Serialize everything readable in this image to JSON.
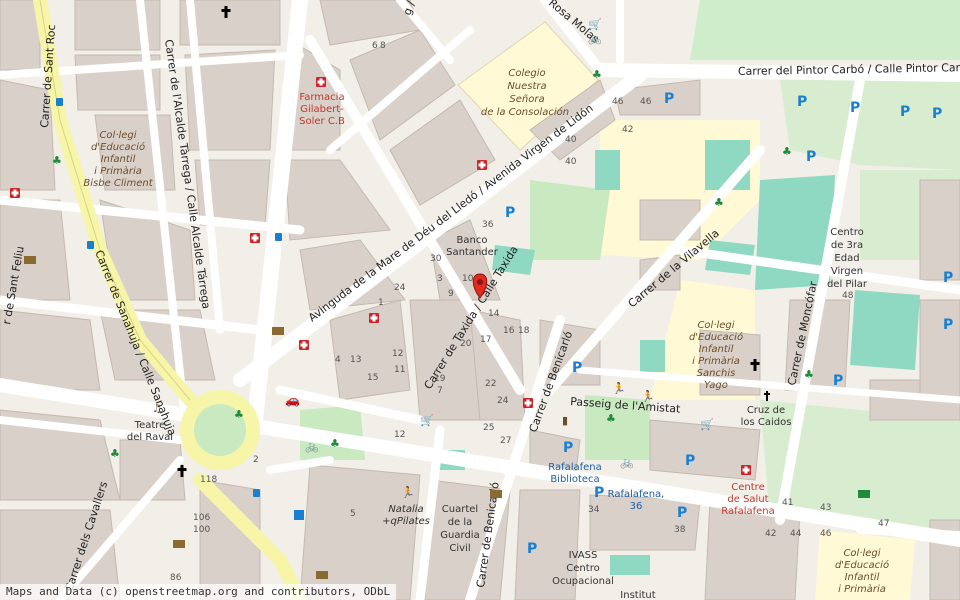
{
  "streets": {
    "pintor_carbo": "Carrer del Pintor Carbó / Calle Pintor Carbó",
    "mare_deu_lledo": "Avinguda de la Mare de Déu del Lledó / Avenida Virgen de Lidón",
    "sanahuja": "Carrer de Sanahuja / Calle Sanahuja",
    "alcalde_tarrega": "Carrer de l'Alcalde Tàrrega / Calle Alcalde Tárrega",
    "sant_roc": "Carrer de Sant Roc",
    "sant_feliu": "r de Sant Feliu",
    "taxida": "Carrer de Taxida / Calle Taxida",
    "benicarlo_1": "Carrer de Benicarló",
    "benicarlo_2": "Carrer de Benicarló",
    "vilavella": "Carrer de la Vilavella",
    "moncofar": "Carrer de Moncófar",
    "amistat": "Passeig de l'Amistat",
    "cavallers": "Carrer dels Cavallers",
    "puig": "g / Calle del Puig",
    "rosa_molas": "Rosa Molas"
  },
  "pois": {
    "colegio_nuestra": [
      "Colegio",
      "Nuestra",
      "Señora",
      "de la Consolación"
    ],
    "farmacia": [
      "Farmacia",
      "Gilabert-",
      "Soler C.B"
    ],
    "collegi_bisbe": [
      "Col·legi",
      "d'Educació",
      "Infantil",
      "i Primària",
      "Bisbe Climent"
    ],
    "banco": [
      "Banco",
      "Santander"
    ],
    "centro_3ra": [
      "Centro",
      "de 3ra",
      "Edad",
      "Virgen",
      "del Pilar"
    ],
    "collegi_sanchis": [
      "Col·legi",
      "d'Educació",
      "Infantil",
      "i Primària",
      "Sanchis",
      "Yago"
    ],
    "cruz": [
      "Cruz de",
      "los Caidos"
    ],
    "teatre": [
      "Teatre",
      "del Raval"
    ],
    "biblioteca": [
      "Rafalafena",
      "Biblioteca"
    ],
    "rafalafena_36": [
      "Rafalafena,",
      "36"
    ],
    "centre_salut": [
      "Centre",
      "de Salut",
      "Rafalafena"
    ],
    "cuartel": [
      "Cuartel",
      "de la",
      "Guardia",
      "Civil"
    ],
    "natalia": [
      "Natalia",
      "+qPilates"
    ],
    "ivass": [
      "IVASS",
      "Centro",
      "Ocupacional"
    ],
    "collegi_bottom": [
      "Col·legi",
      "d'Educació",
      "Infantil",
      "i Primària"
    ],
    "institut": "Institut"
  },
  "house_numbers": {
    "n6": "6",
    "n8": "8",
    "n46a": "46",
    "n46b": "46",
    "n40a": "40",
    "n42": "42",
    "n40b": "40",
    "n36": "36",
    "n30": "30",
    "n10": "10",
    "n3": "3",
    "n24": "24",
    "n9": "9",
    "n1": "1",
    "n14": "14",
    "n16": "16",
    "n18": "18",
    "n17": "17",
    "n20": "20",
    "n12a": "12",
    "n22": "22",
    "n19": "19",
    "n7": "7",
    "n4": "4",
    "n11": "11",
    "n24b": "24",
    "n25": "25",
    "n27": "27",
    "n12b": "12",
    "n118": "118",
    "n106": "106",
    "n100": "100",
    "n86": "86",
    "n34": "34",
    "n38": "38",
    "n41": "41",
    "n43": "43",
    "n44": "44",
    "n46c": "46",
    "n47": "47",
    "n42b": "42",
    "n48": "48",
    "n2": "2",
    "n5": "5",
    "n15": "15",
    "n13": "13"
  },
  "attribution": "Maps and Data (c) openstreetmap.org and contributors, ODbL",
  "icons": {
    "marker": "location-marker-icon",
    "pharmacy": "pharmacy-cross-icon",
    "parking": "parking-P-icon",
    "church": "church-cross-icon",
    "bus": "bus-stop-icon",
    "school": "playground-icon"
  },
  "colors": {
    "background": "#f2efe9",
    "building": "#d9d0c9",
    "road": "#ffffff",
    "primary_road": "#f7f5a8",
    "school_area": "#fff9d6",
    "park": "#c9e9c0",
    "pitch": "#8fd9c3",
    "marker": "#e22a1f"
  }
}
